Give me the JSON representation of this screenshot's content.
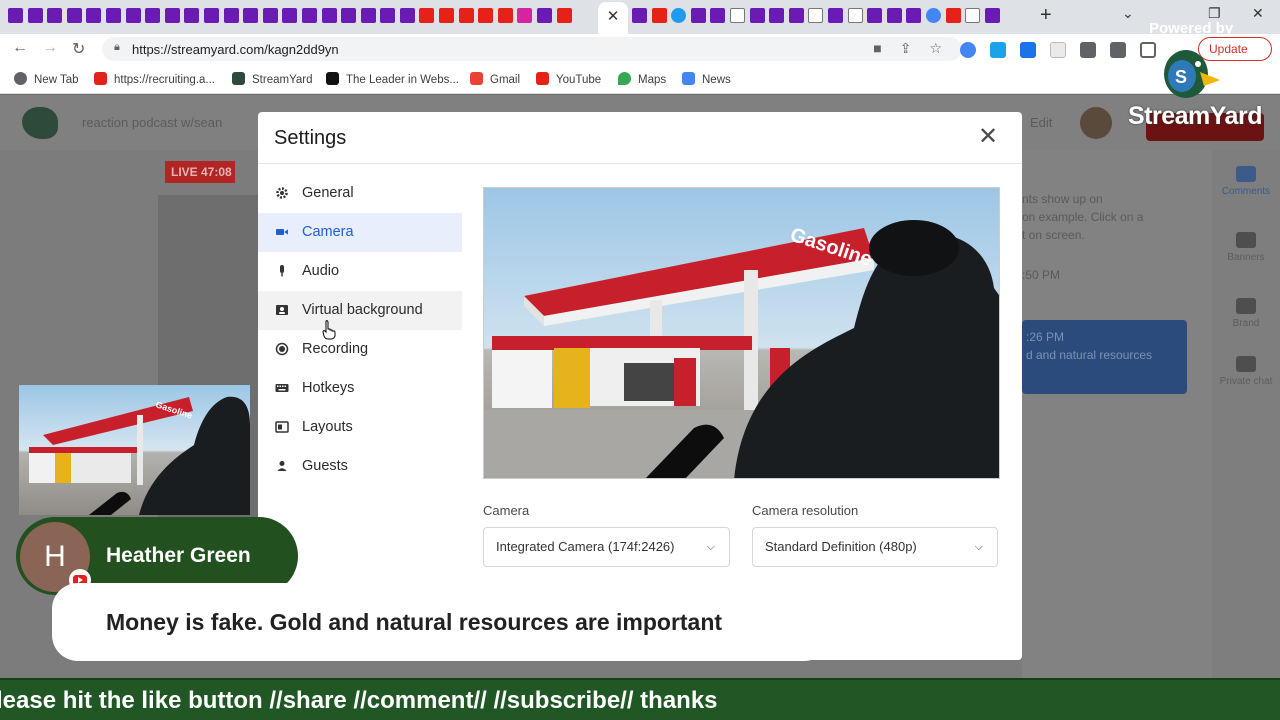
{
  "browser": {
    "url": "https://streamyard.com/kagn2dd9yn",
    "update_label": "Update",
    "bookmarks": [
      "New Tab",
      "https://recruiting.a...",
      "StreamYard",
      "The Leader in Webs...",
      "Gmail",
      "YouTube",
      "Maps",
      "News"
    ]
  },
  "app": {
    "broadcast_title": "reaction podcast w/sean",
    "edit_label": "Edit",
    "live_label": "LIVE 47:08",
    "right_panel": {
      "line1": "nts show up on",
      "line2": "on example. Click on a",
      "line3": "t on screen.",
      "time1": ":50 PM",
      "time2": ":26 PM",
      "card_text": "d and natural resources"
    },
    "side_nav": [
      "Comments",
      "Banners",
      "Brand",
      "Private chat"
    ]
  },
  "settings": {
    "title": "Settings",
    "menu": [
      {
        "label": "General",
        "icon": "gear-icon"
      },
      {
        "label": "Camera",
        "icon": "camera-icon"
      },
      {
        "label": "Audio",
        "icon": "microphone-icon"
      },
      {
        "label": "Virtual background",
        "icon": "portrait-icon"
      },
      {
        "label": "Recording",
        "icon": "record-icon"
      },
      {
        "label": "Hotkeys",
        "icon": "keyboard-icon"
      },
      {
        "label": "Layouts",
        "icon": "layout-icon"
      },
      {
        "label": "Guests",
        "icon": "person-icon"
      }
    ],
    "active_item": "Camera",
    "camera_label": "Camera",
    "camera_value": "Integrated Camera (174f:2426)",
    "resolution_label": "Camera resolution",
    "resolution_value": "Standard Definition (480p)",
    "preview_sign": "Gasoline"
  },
  "overlay": {
    "powered_by": "Powered by",
    "logo_text": "StreamYard",
    "commenter_initial": "H",
    "commenter_name": "Heather Green",
    "comment": "Money is fake. Gold and natural resources are important",
    "ticker": "lease hit the like button //share //comment// //subscribe// thanks"
  },
  "colors": {
    "accent": "#1f5fd1",
    "ticker_green": "#215725",
    "live_red": "#b12525"
  }
}
